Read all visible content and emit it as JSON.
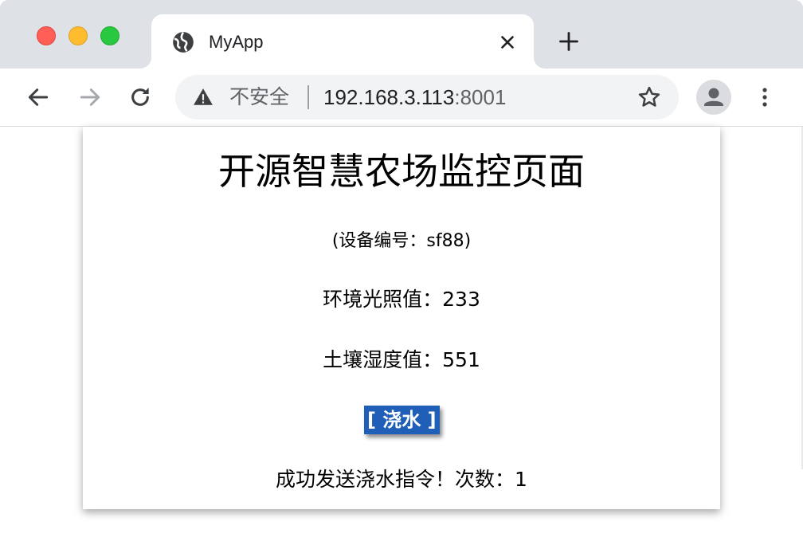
{
  "browser": {
    "tab": {
      "title": "MyApp"
    },
    "address_bar": {
      "security_label": "不安全",
      "host": "192.168.3.113",
      "port": ":8001"
    },
    "colors": {
      "tabstrip": "#dee1e6",
      "omnibox": "#f1f3f4",
      "close_dot": "#ff5f57",
      "minimize_dot": "#febc2e",
      "zoom_dot": "#28c840"
    },
    "icons": {
      "favicon": "globe-icon",
      "close_tab": "close-icon",
      "new_tab": "plus-icon",
      "back": "arrow-left-icon",
      "forward": "arrow-right-icon",
      "reload": "reload-icon",
      "security": "warning-icon",
      "bookmark": "star-icon",
      "profile": "person-icon",
      "menu": "kebab-menu-icon"
    }
  },
  "page": {
    "title": "开源智慧农场监控页面",
    "device_label": "(设备编号：sf88)",
    "light_label": "环境光照值：",
    "light_value": "233",
    "soil_label": "土壤湿度值：",
    "soil_value": "551",
    "water_button": "[ 浇水 ]",
    "result_label": "成功发送浇水指令！次数：",
    "result_count": "1",
    "button_color": "#1f5fb8"
  }
}
